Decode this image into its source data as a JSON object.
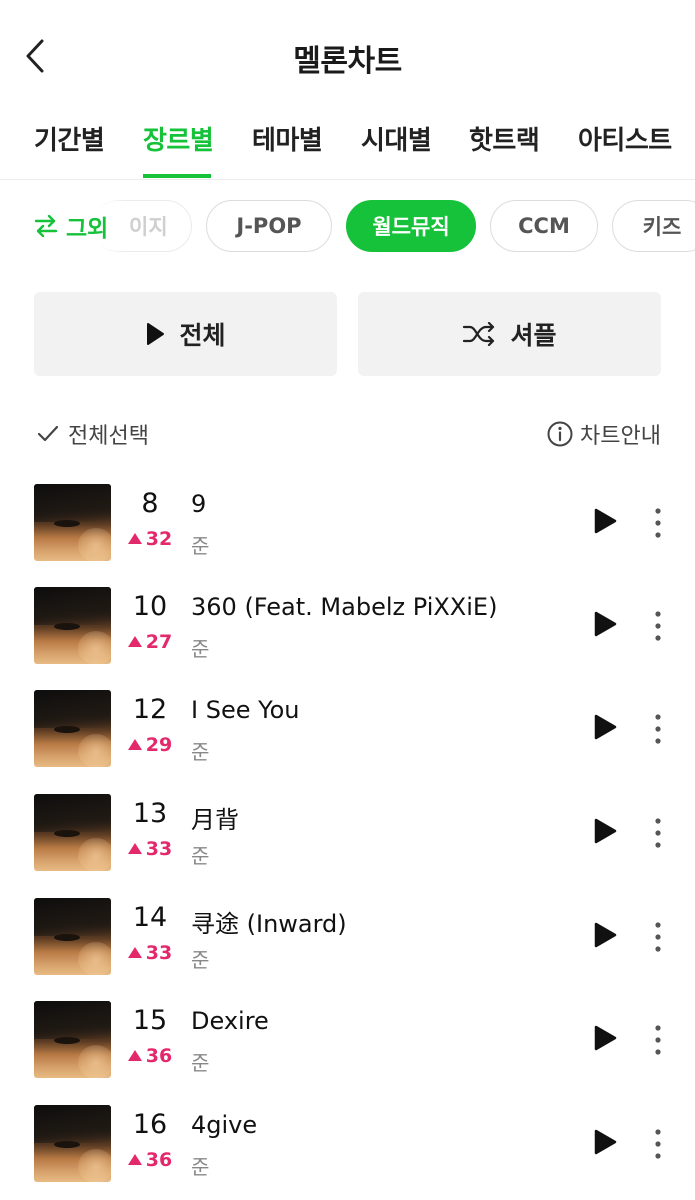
{
  "header": {
    "title": "멜론차트",
    "back_icon": "chevron-left-icon"
  },
  "tabs": [
    {
      "label": "기간별"
    },
    {
      "label": "장르별",
      "active": true
    },
    {
      "label": "테마별"
    },
    {
      "label": "시대별"
    },
    {
      "label": "핫트랙"
    },
    {
      "label": "아티스트"
    }
  ],
  "genre_chips": {
    "swap_label": "그외",
    "partial_label": "이지",
    "items": [
      {
        "label": "J-POP"
      },
      {
        "label": "월드뮤직",
        "active": true
      },
      {
        "label": "CCM"
      },
      {
        "label": "키즈"
      }
    ]
  },
  "actions": {
    "play_all": "전체",
    "shuffle": "셔플"
  },
  "list_header": {
    "select_all": "전체선택",
    "chart_info": "차트안내"
  },
  "songs": [
    {
      "rank": "8",
      "change": "32",
      "title": "9",
      "artist": "준"
    },
    {
      "rank": "10",
      "change": "27",
      "title": "360 (Feat. Mabelz PiXXiE)",
      "artist": "준"
    },
    {
      "rank": "12",
      "change": "29",
      "title": "I See You",
      "artist": "준"
    },
    {
      "rank": "13",
      "change": "33",
      "title": "月背",
      "artist": "준"
    },
    {
      "rank": "14",
      "change": "33",
      "title": "寻途 (Inward)",
      "artist": "준"
    },
    {
      "rank": "15",
      "change": "36",
      "title": "Dexire",
      "artist": "준"
    },
    {
      "rank": "16",
      "change": "36",
      "title": "4give",
      "artist": "준"
    }
  ],
  "colors": {
    "accent": "#16c23a",
    "rank_up": "#e3286b"
  }
}
